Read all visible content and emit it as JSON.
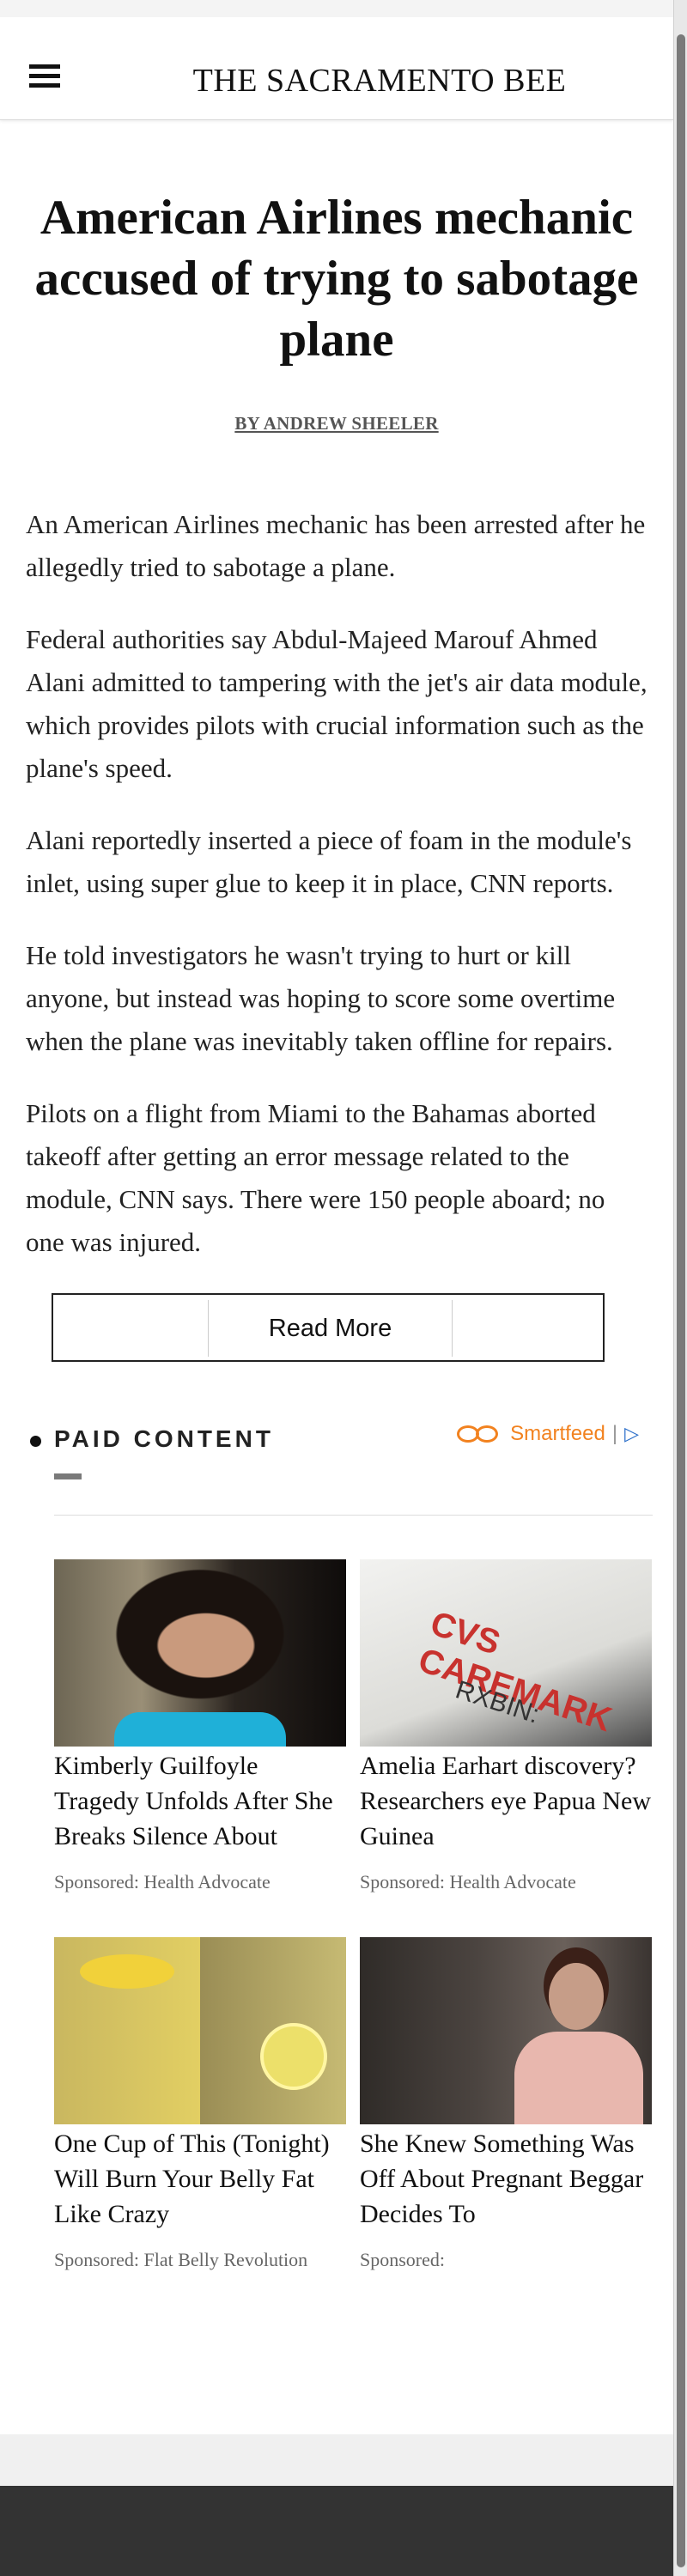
{
  "header": {
    "masthead": "THE SACRAMENTO BEE"
  },
  "article": {
    "headline": "American Airlines mechanic accused of trying to sabotage plane",
    "byline": "BY ANDREW SHEELER",
    "paragraphs": [
      "An American Airlines mechanic has been arrested after he allegedly tried to sabotage a plane.",
      "Federal authorities say Abdul-Majeed Marouf Ahmed Alani admitted to tampering with the jet's air data module, which provides pilots with crucial information such as the plane's speed.",
      "Alani reportedly inserted a piece of foam in the module's inlet, using super glue to keep it in place, CNN reports.",
      "He told investigators he wasn't trying to hurt or kill anyone, but instead was hoping to score some overtime when the plane was inevitably taken offline for repairs.",
      "Pilots on a flight from Miami to the Bahamas aborted takeoff after getting an error message related to the module, CNN says. There were 150 people aboard; no one was injured."
    ],
    "read_more_label": "Read More"
  },
  "paid_content": {
    "title": "PAID CONTENT",
    "provider": "Smartfeed",
    "provider_separator": "|",
    "ad_choices": "▷",
    "cards": [
      {
        "title": "Kimberly Guilfoyle Tragedy Unfolds After She Breaks Silence About",
        "source": "Sponsored: Health Advocate",
        "image_text": ""
      },
      {
        "title": "Amelia Earhart discovery? Researchers eye Papua New Guinea",
        "source": "Sponsored: Health Advocate",
        "image_text": "CVS CAREMARK",
        "image_subtext": "RXBIN:"
      },
      {
        "title": "One Cup of This (Tonight) Will Burn Your Belly Fat Like Crazy",
        "source": "Sponsored: Flat Belly Revolution",
        "image_text": ""
      },
      {
        "title": "She Knew Something Was Off About Pregnant Beggar Decides To",
        "source": "Sponsored:",
        "image_text": ""
      }
    ]
  },
  "colors": {
    "accent_orange": "#f2821f",
    "ad_blue": "#2a6ec9",
    "footer": "#333333"
  }
}
